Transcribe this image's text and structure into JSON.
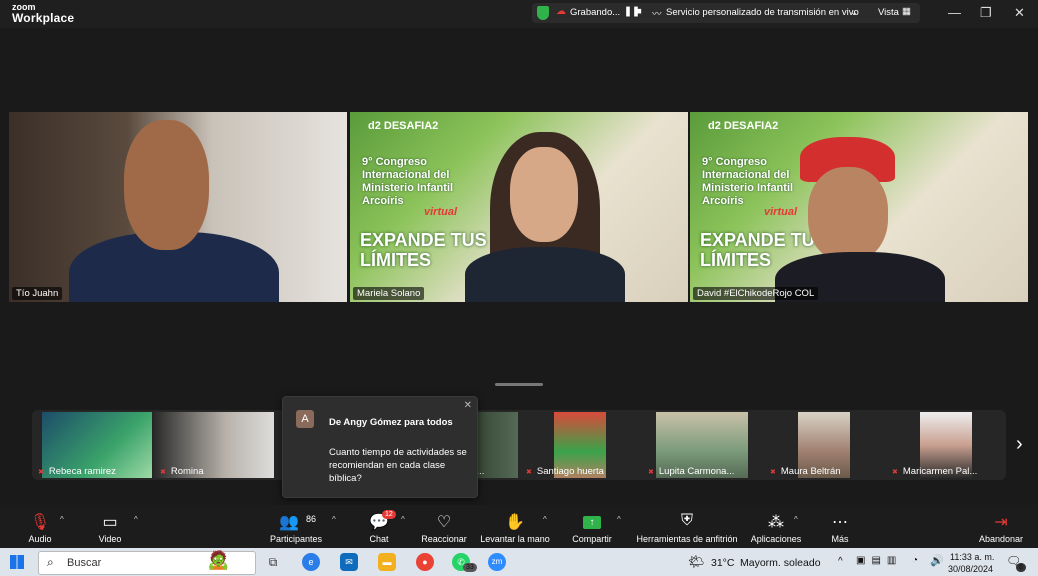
{
  "app": {
    "brand_top": "zoom",
    "brand_bottom": "Workplace"
  },
  "recording": {
    "label": "Grabando...",
    "stream": "Servicio personalizado de transmisión en vivo",
    "view": "Vista"
  },
  "window_controls": {
    "minimize": "—",
    "maximize": "❐",
    "close": "✕"
  },
  "banner": {
    "logo": "d2 DESAFIA2",
    "line1": "9° Congreso Internacional del Ministerio Infantil Arcoíris",
    "virtual": "virtual",
    "slogan": "EXPANDE TUS LÍMITES"
  },
  "speakers": [
    {
      "name": "Tío Juahn"
    },
    {
      "name": "Mariela Solano"
    },
    {
      "name": "David #ElChikodeRojo COL"
    }
  ],
  "thumbnails": [
    {
      "name": "Rebeca ramirez"
    },
    {
      "name": "Romina"
    },
    {
      "name": "EL..."
    },
    {
      "name": "Santiago huerta"
    },
    {
      "name": "Lupita Carmona..."
    },
    {
      "name": "Maura Beltrán"
    },
    {
      "name": "Maricarmen Pal..."
    }
  ],
  "chat_popup": {
    "avatar": "A",
    "from": "De Angy Gómez para todos",
    "message": "Cuanto tiempo de actividades se recomiendan en cada clase bíblica?",
    "close": "✕"
  },
  "toolbar": {
    "audio": "Audio",
    "video": "Video",
    "participants": "Participantes",
    "participants_count": "86",
    "chat": "Chat",
    "chat_badge": "12",
    "reactions": "Reaccionar",
    "raise_hand": "Levantar la mano",
    "share": "Compartir",
    "host_tools": "Herramientas de anfitrión",
    "apps": "Aplicaciones",
    "more": "Más",
    "leave": "Abandonar"
  },
  "taskbar": {
    "search_placeholder": "Buscar",
    "weather": "31°C",
    "weather_desc": "Mayorm. soleado",
    "time": "11:33 a. m.",
    "date": "30/08/2024",
    "whatsapp_badge": "33",
    "zoom_label": "zm",
    "notif_count": "6"
  },
  "colors": {
    "active_speaker": "#3ddc84",
    "muted": "#e53935",
    "share_green": "#2fb34a"
  }
}
